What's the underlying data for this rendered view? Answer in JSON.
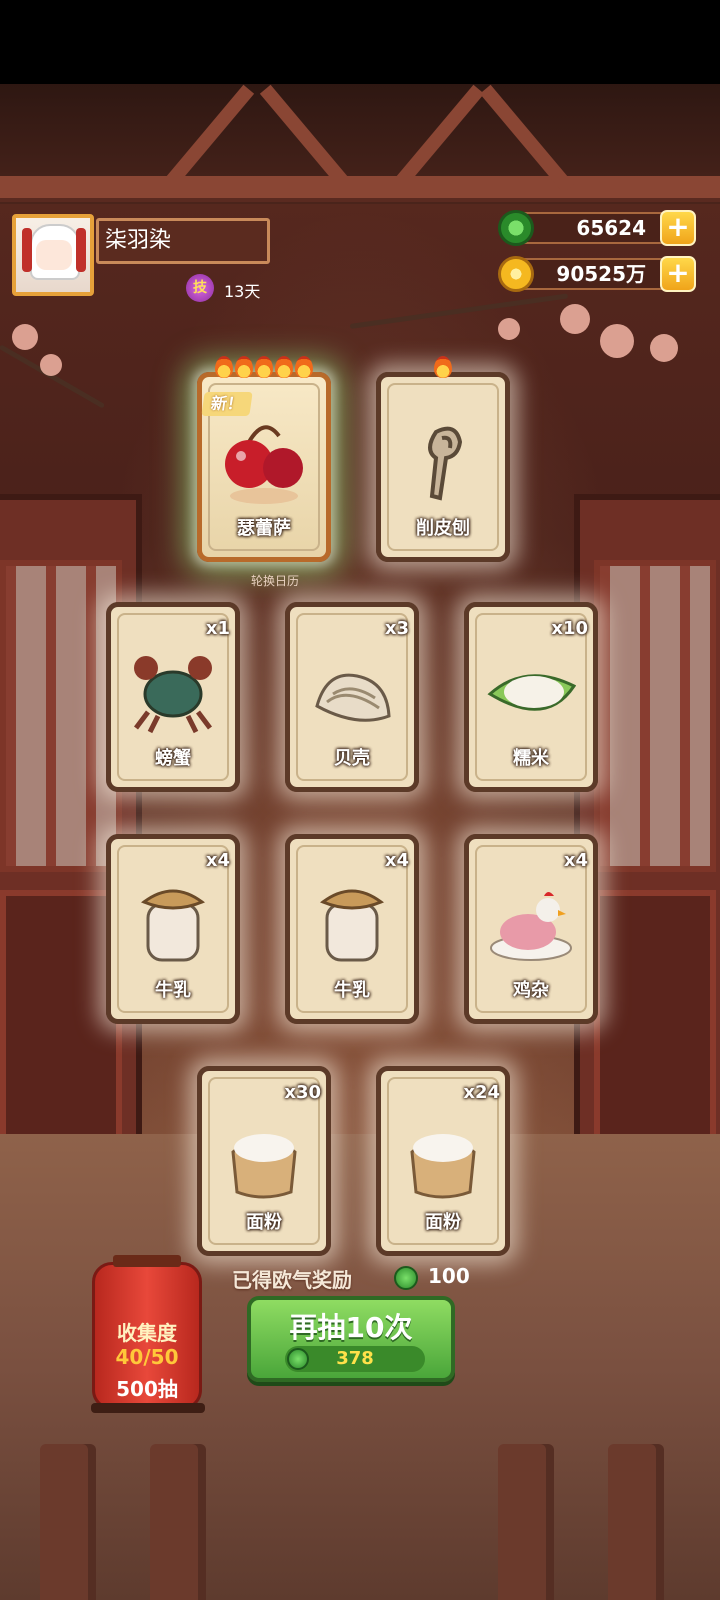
{
  "player": {
    "name": "柒羽染",
    "skill_icon": "技",
    "days": "13天"
  },
  "currency": {
    "jade": {
      "value": "65624",
      "icon": "jade-coin-icon"
    },
    "gold": {
      "value": "90525万",
      "icon": "gold-coin-icon"
    },
    "plus": "+"
  },
  "featured": [
    {
      "name": "瑟蕾萨",
      "stars": 5,
      "new_tag": "新！",
      "icon": "cherry-icon"
    },
    {
      "name": "削皮刨",
      "stars": 1,
      "icon": "peeler-icon"
    }
  ],
  "calendar_label": "轮换日历",
  "items": [
    {
      "name": "螃蟹",
      "qty": "x1",
      "icon": "crab-icon"
    },
    {
      "name": "贝壳",
      "qty": "x3",
      "icon": "shell-icon"
    },
    {
      "name": "糯米",
      "qty": "x10",
      "icon": "rice-icon"
    },
    {
      "name": "牛乳",
      "qty": "x4",
      "icon": "milk-jar-icon"
    },
    {
      "name": "牛乳",
      "qty": "x4",
      "icon": "milk-jar-icon"
    },
    {
      "name": "鸡杂",
      "qty": "x4",
      "icon": "chicken-icon"
    },
    {
      "name": "面粉",
      "qty": "x30",
      "icon": "flour-sack-icon"
    },
    {
      "name": "面粉",
      "qty": "x24",
      "icon": "flour-sack-icon"
    }
  ],
  "bonus": {
    "label": "已得欧气奖励",
    "value": "100"
  },
  "draw_button": {
    "label": "再抽10次",
    "cost": "378"
  },
  "collection": {
    "title": "收集度",
    "progress": "40/50",
    "pulls": "500抽"
  }
}
